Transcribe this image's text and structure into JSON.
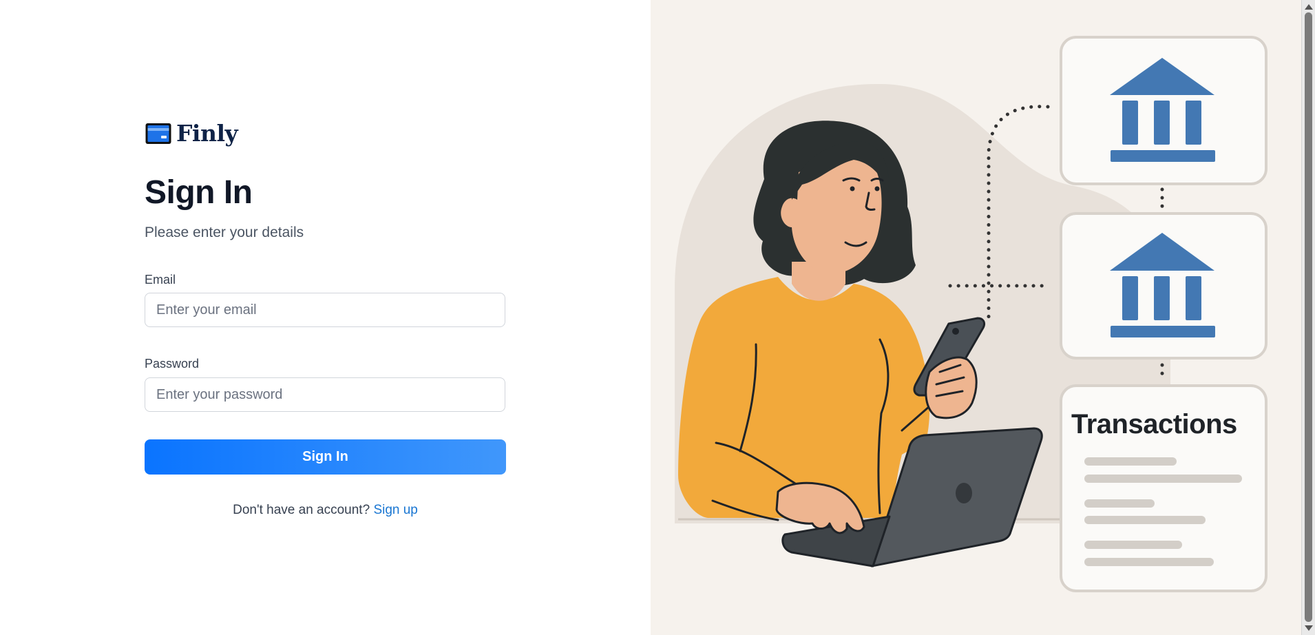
{
  "brand": {
    "name": "Finly",
    "icon": "credit-card-icon"
  },
  "signin": {
    "title": "Sign In",
    "subtitle": "Please enter your details",
    "email_label": "Email",
    "email_placeholder": "Enter your email",
    "email_value": "",
    "password_label": "Password",
    "password_placeholder": "Enter your password",
    "password_value": "",
    "submit_label": "Sign In",
    "no_account_text": "Don't have an account?",
    "signup_link": "Sign up"
  },
  "illustration": {
    "card_title": "Transactions",
    "icons": [
      "bank-icon",
      "bank-icon",
      "transactions-card-icon",
      "woman-with-phone-and-laptop"
    ]
  },
  "colors": {
    "primary": "#0a74ff",
    "primary_end": "#4097fb",
    "link": "#1976d2",
    "brand_text": "#0f2347",
    "illustration_bg": "#f6f2ed",
    "bank_blue": "#4378b3",
    "sweater": "#f2a93b"
  }
}
